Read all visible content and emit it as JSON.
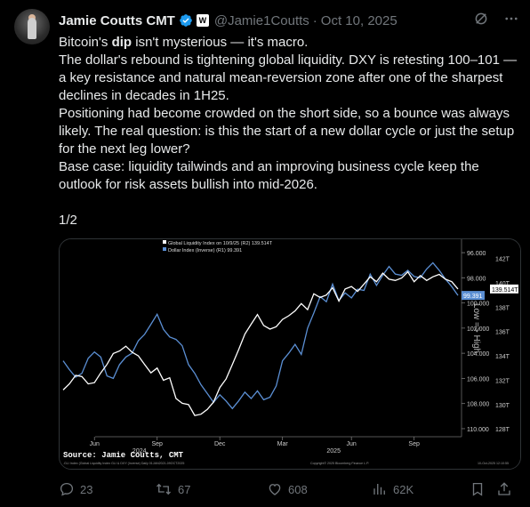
{
  "author": {
    "name": "Jamie Coutts CMT",
    "handle": "@Jamie1Coutts",
    "separator": "·",
    "date": "Oct 10, 2025",
    "badge_letter": "W"
  },
  "tweet": {
    "line1_pre": "Bitcoin's ",
    "line1_bold": "dip",
    "line1_post": " isn't mysterious — it's macro.",
    "para2": "The dollar's rebound is tightening global liquidity. DXY is retesting 100–101 — a key resistance and natural mean-reversion zone after one of the sharpest declines in decades in 1H25.",
    "para3": "Positioning had become crowded on the short side, so a bounce was always likely. The real question: is this the start of a new dollar cycle or just the setup for the next leg lower?",
    "para4": "Base case: liquidity tailwinds and an improving business cycle keep the outlook for risk assets bullish into mid-2026.",
    "thread_marker": "1/2"
  },
  "actions": {
    "replies": "23",
    "reposts": "67",
    "likes": "608",
    "views": "62K"
  },
  "chart_data": {
    "type": "line",
    "legend": [
      "Global Liquidity Index on 10/9/25 (R2) 139.514T",
      "Dollar Index (Inverse) (R1) 99.391"
    ],
    "x_tick_labels": [
      "Jun",
      "Sep",
      "Dec",
      "Mar",
      "Jun",
      "Sep"
    ],
    "year_labels": [
      "2024",
      "2025"
    ],
    "right_axis_dxy_inverted": [
      "96.000",
      "98.000",
      "100.000",
      "102.000",
      "104.000",
      "106.000",
      "108.000",
      "110.000"
    ],
    "right_axis_gli": [
      "142T",
      "140T",
      "138T",
      "136T",
      "134T",
      "132T",
      "130T",
      "128T"
    ],
    "last_value_labels": [
      "139.514T",
      "99.391"
    ],
    "axis_note": "Low => High",
    "source": "Source: Jamie Coutts, CMT",
    "footer_left": ".GLI Index (Global Liquidity Index GLI & DXY (Inverse) Daily 01JAN2021-09OCT2025",
    "footer_mid": "Copyright© 2025 Bloomberg Finance L.P.",
    "footer_right": "10-Oct-2025 12:10:55",
    "ylim_dxy": [
      110.5,
      95.5
    ],
    "ylim_gli": [
      127.5,
      143
    ],
    "series": [
      {
        "name": "Dollar Index (Inverse)",
        "color": "#5b8fd4",
        "values": [
          104.6,
          105.3,
          105.9,
          105.6,
          104.4,
          103.9,
          104.3,
          105.8,
          106.0,
          104.9,
          104.3,
          104.0,
          103.0,
          102.5,
          101.7,
          100.9,
          102.1,
          102.7,
          102.9,
          103.4,
          104.9,
          105.6,
          106.5,
          107.2,
          107.9,
          107.3,
          107.8,
          108.4,
          107.8,
          107.1,
          107.6,
          107.0,
          107.7,
          107.5,
          106.6,
          104.6,
          104.0,
          103.3,
          104.1,
          102.0,
          100.8,
          99.5,
          99.9,
          98.5,
          99.8,
          99.2,
          99.6,
          98.9,
          99.0,
          97.7,
          98.6,
          97.8,
          97.1,
          97.7,
          97.8,
          97.4,
          97.9,
          98.0,
          97.3,
          96.8,
          97.4,
          98.1,
          98.7,
          99.4
        ]
      },
      {
        "name": "Global Liquidity Index",
        "color": "#ffffff",
        "values": [
          131.2,
          131.7,
          132.4,
          132.3,
          131.7,
          131.8,
          132.6,
          133.3,
          134.2,
          134.4,
          134.8,
          134.3,
          134.0,
          133.3,
          132.6,
          133.0,
          132.0,
          132.2,
          130.5,
          130.1,
          130.0,
          129.1,
          129.2,
          129.6,
          130.2,
          131.4,
          132.1,
          133.3,
          134.5,
          135.8,
          136.6,
          137.4,
          136.5,
          136.2,
          136.4,
          137.0,
          137.3,
          137.7,
          138.3,
          137.8,
          139.1,
          138.8,
          139.0,
          139.6,
          138.5,
          139.5,
          139.7,
          139.3,
          139.9,
          140.5,
          140.1,
          140.8,
          140.3,
          140.2,
          140.4,
          140.9,
          140.1,
          140.6,
          140.2,
          140.5,
          140.7,
          140.3,
          140.1,
          139.5
        ]
      }
    ]
  }
}
